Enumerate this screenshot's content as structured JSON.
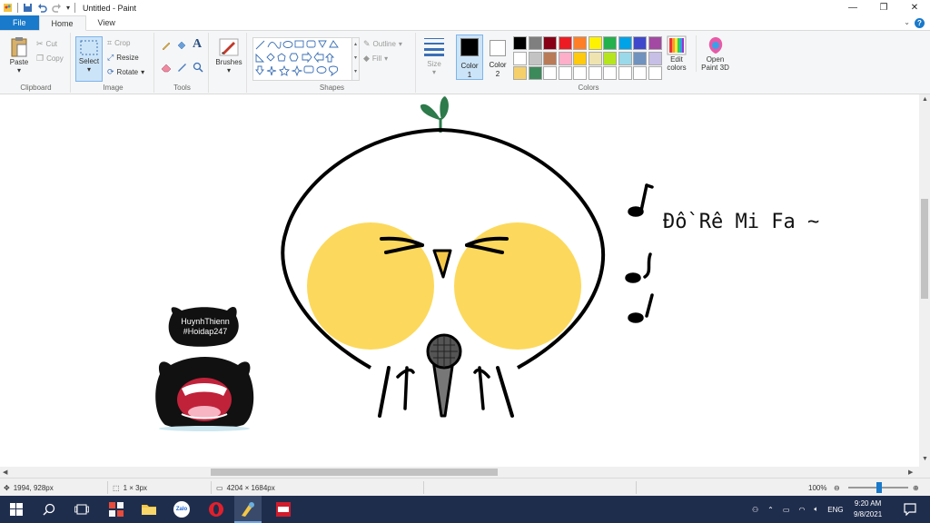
{
  "window": {
    "title": "Untitled - Paint"
  },
  "tabs": [
    {
      "label": "File"
    },
    {
      "label": "Home"
    },
    {
      "label": "View"
    }
  ],
  "ribbon": {
    "clipboard": {
      "paste": "Paste",
      "cut": "Cut",
      "copy": "Copy",
      "label": "Clipboard"
    },
    "image": {
      "select": "Select",
      "crop": "Crop",
      "resize": "Resize",
      "rotate": "Rotate",
      "label": "Image"
    },
    "tools": {
      "label": "Tools"
    },
    "brushes": {
      "label": "Brushes"
    },
    "shapes": {
      "outline": "Outline",
      "fill": "Fill",
      "label": "Shapes"
    },
    "size": {
      "label": "Size"
    },
    "color1": {
      "label": "Color",
      "num": "1",
      "value": "#000000"
    },
    "color2": {
      "label": "Color",
      "num": "2",
      "value": "#ffffff"
    },
    "colors": {
      "label": "Colors",
      "row1": [
        "#000000",
        "#7f7f7f",
        "#880015",
        "#ed1c24",
        "#ff7f27",
        "#fff200",
        "#22b14c",
        "#00a2e8",
        "#3f48cc",
        "#a349a4"
      ],
      "row2": [
        "#ffffff",
        "#c3c3c3",
        "#b97a57",
        "#ffaec9",
        "#ffc90e",
        "#efe4b0",
        "#b5e61d",
        "#99d9ea",
        "#7092be",
        "#c8bfe7"
      ],
      "row3": [
        "#f5d06a",
        "#3c8a5a",
        "#ffffff",
        "#ffffff",
        "#ffffff",
        "#ffffff",
        "#ffffff",
        "#ffffff",
        "#ffffff",
        "#ffffff"
      ]
    },
    "edit_colors": {
      "line1": "Edit",
      "line2": "colors"
    },
    "paint3d": {
      "line1": "Open",
      "line2": "Paint 3D"
    }
  },
  "canvas": {
    "text": "Đồ Rê Mi Fa ~",
    "sticker": {
      "line1": "HuynhThienn",
      "line2": "#Hoidap247"
    }
  },
  "status": {
    "cursor": "1994, 928px",
    "selection": "1 × 3px",
    "image_size": "4204 × 1684px",
    "zoom": "100%"
  },
  "taskbar": {
    "zalo": "Zalo",
    "language": "ENG",
    "time": "9:20 AM",
    "date": "9/8/2021"
  }
}
